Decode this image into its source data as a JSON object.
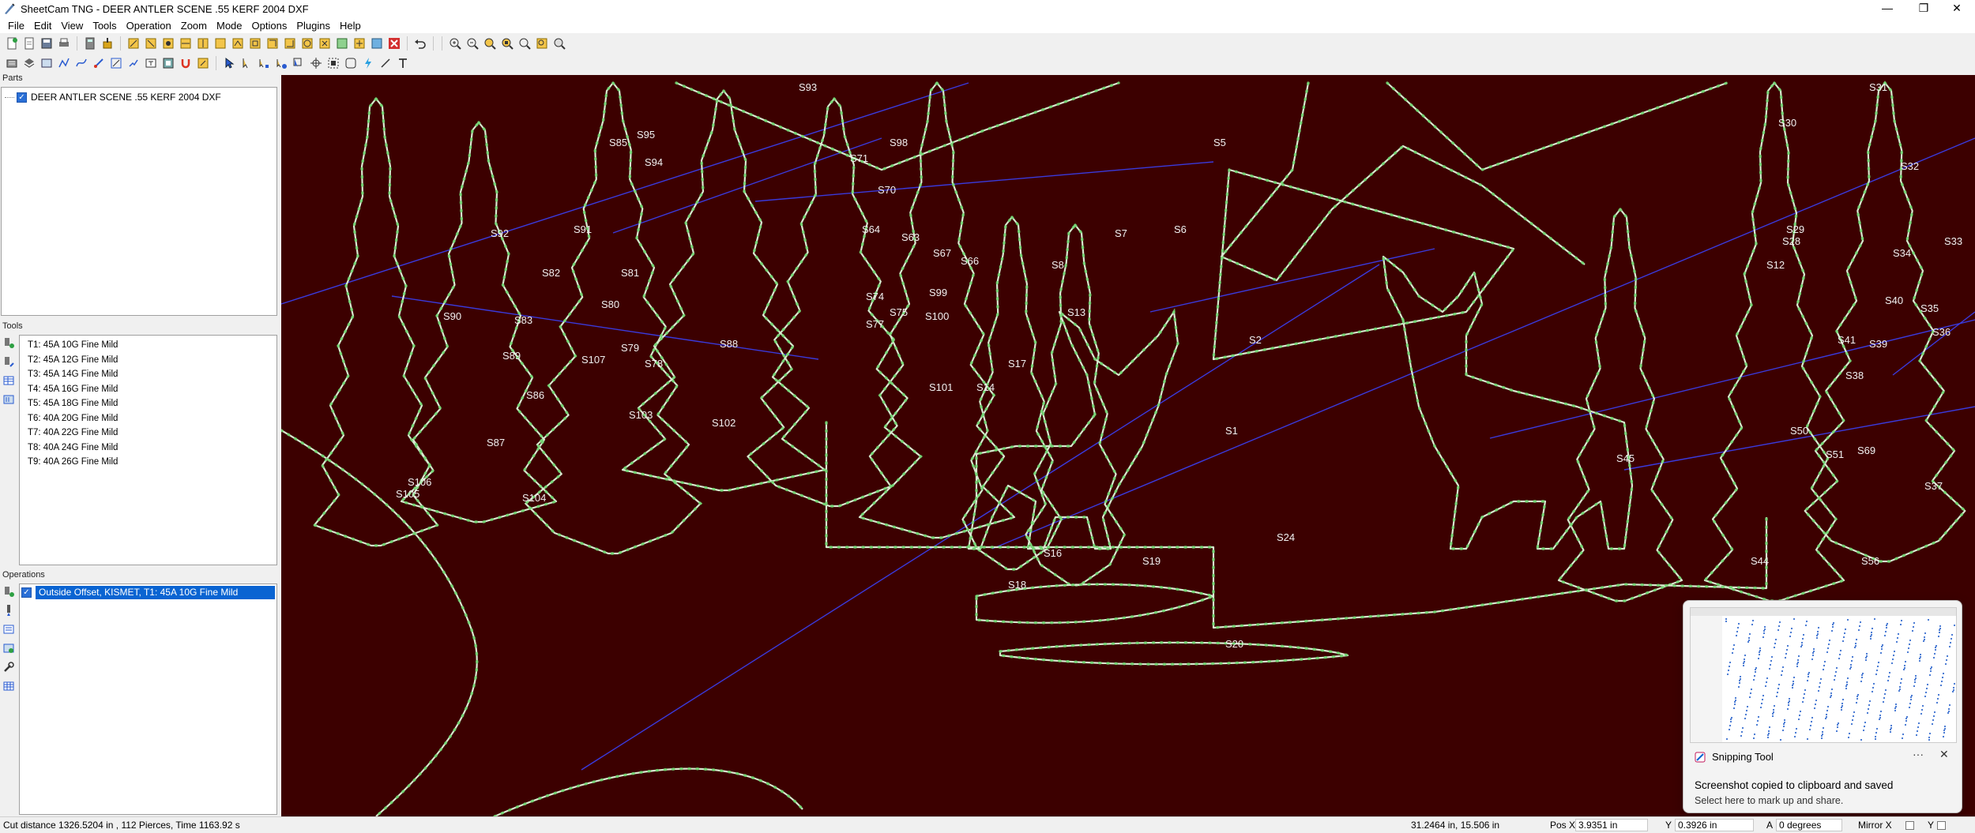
{
  "window": {
    "title": "SheetCam TNG - DEER ANTLER SCENE .55 KERF 2004 DXF",
    "minimize_glyph": "—",
    "maximize_glyph": "❐",
    "close_glyph": "✕"
  },
  "menu": [
    "File",
    "Edit",
    "View",
    "Tools",
    "Operation",
    "Zoom",
    "Mode",
    "Options",
    "Plugins",
    "Help"
  ],
  "panels": {
    "parts": {
      "header": "Parts",
      "items": [
        {
          "label": "DEER ANTLER SCENE .55 KERF 2004 DXF",
          "checked": true
        }
      ]
    },
    "tools": {
      "header": "Tools",
      "items": [
        "T1: 45A 10G Fine Mild",
        "T2: 45A 12G Fine Mild",
        "T3: 45A 14G Fine Mild",
        "T4: 45A 16G Fine Mild",
        "T5: 45A 18G Fine Mild",
        "T6: 40A 20G Fine Mild",
        "T7: 40A 22G Fine Mild",
        "T8: 40A 24G Fine Mild",
        "T9: 40A 26G Fine Mild"
      ]
    },
    "operations": {
      "header": "Operations",
      "items": [
        {
          "label": "Outside Offset, KISMET, T1: 45A 10G Fine Mild",
          "checked": true,
          "selected": true
        }
      ]
    }
  },
  "canvas": {
    "background": "#3c0000",
    "outline_color": "#d8ead0",
    "point_color": "#6fd36f",
    "rapid_color": "#3a3adc",
    "labels": [
      "S93",
      "S98",
      "S95",
      "S85",
      "S94",
      "S71",
      "S70",
      "S5",
      "S91",
      "S64",
      "S63",
      "S67",
      "S66",
      "S92",
      "S7",
      "S6",
      "S8",
      "S82",
      "S81",
      "S80",
      "S74",
      "S75",
      "S77",
      "S99",
      "S100",
      "S90",
      "S83",
      "S88",
      "S89",
      "S107",
      "S79",
      "S78",
      "S101",
      "S86",
      "S102",
      "S103",
      "S87",
      "S106",
      "S105",
      "S104",
      "S31",
      "S30",
      "S32",
      "S34",
      "S33",
      "S29",
      "S28",
      "S12",
      "S13",
      "S2",
      "S1",
      "S16",
      "S18",
      "S19",
      "S20",
      "S24",
      "S40",
      "S41",
      "S39",
      "S38",
      "S35",
      "S36",
      "S69",
      "S37",
      "S50",
      "S51",
      "S45",
      "S44",
      "S56",
      "S17",
      "S14"
    ]
  },
  "toast": {
    "app_name": "Snipping Tool",
    "message": "Screenshot copied to clipboard and saved",
    "sub": "Select here to mark up and share.",
    "more_glyph": "···",
    "close_glyph": "✕"
  },
  "status": {
    "summary": "Cut distance 1326.5204 in , 112 Pierces, Time 1163.92 s",
    "cursor": "31.2464 in, 15.506 in",
    "pos_x_label": "Pos X",
    "pos_x": "3.9351 in",
    "y_label": "Y",
    "y": "0.3926 in",
    "angle_label": "A",
    "angle": "0 degrees",
    "mirror_label": "Mirror X",
    "mirror_y_label": "Y"
  }
}
